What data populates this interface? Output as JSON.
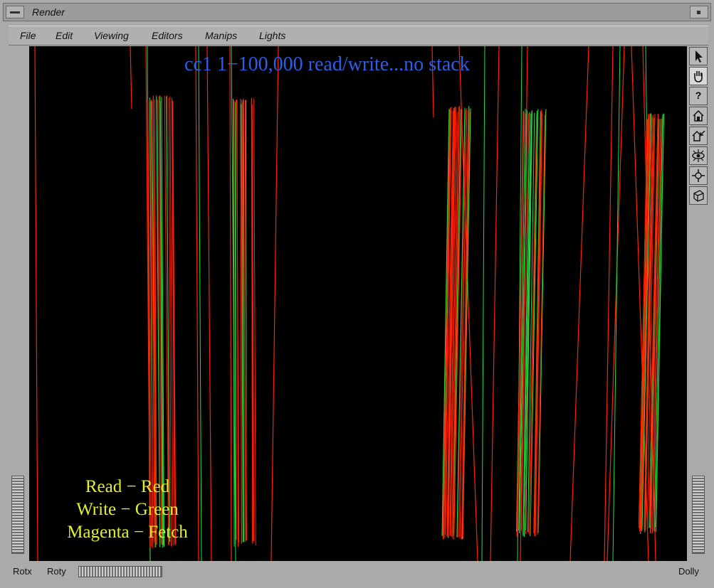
{
  "window": {
    "title": "Render"
  },
  "menu": {
    "items": [
      "File",
      "Edit",
      "Viewing",
      "Editors",
      "Manips",
      "Lights"
    ]
  },
  "viewport": {
    "title": "cc1  1−100,000 read/write...no stack",
    "title_color": "#2d5fe6",
    "background": "#000000",
    "legend": [
      "Read − Red",
      "Write − Green",
      "Magenta − Fetch"
    ],
    "legend_color": "#e4ee2a",
    "colors": {
      "read": "#ff2200",
      "write": "#22dd44"
    }
  },
  "toolbar": {
    "tools": [
      {
        "icon": "select-arrow-icon",
        "label": "Select",
        "active": false
      },
      {
        "icon": "view-hand-icon",
        "label": "View",
        "active": true
      },
      {
        "icon": "help-icon",
        "label": "?",
        "active": false
      },
      {
        "icon": "home-icon",
        "label": "Home",
        "active": false
      },
      {
        "icon": "set-home-icon",
        "label": "Set Home",
        "active": false
      },
      {
        "icon": "view-all-icon",
        "label": "View All",
        "active": false
      },
      {
        "icon": "seek-icon",
        "label": "Seek",
        "active": false
      },
      {
        "icon": "perspective-cube-icon",
        "label": "Camera",
        "active": false
      }
    ]
  },
  "bottom_bar": {
    "rotx_label": "Rotx",
    "roty_label": "Roty",
    "dolly_label": "Dolly"
  }
}
